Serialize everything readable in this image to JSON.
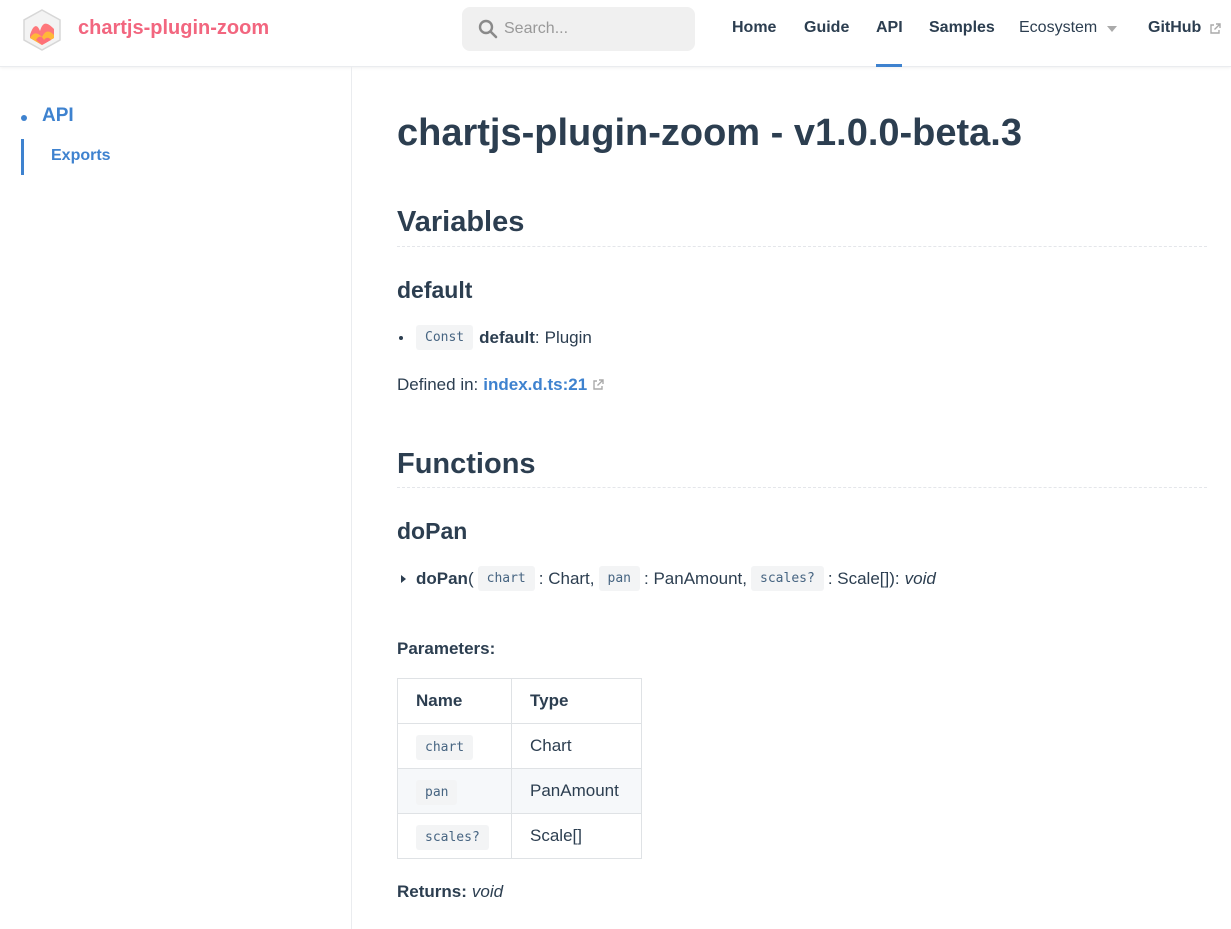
{
  "header": {
    "site_name": "chartjs-plugin-zoom",
    "search_placeholder": "Search...",
    "nav": [
      {
        "label": "Home"
      },
      {
        "label": "Guide"
      },
      {
        "label": "API"
      },
      {
        "label": "Samples"
      },
      {
        "label": "Ecosystem"
      },
      {
        "label": "GitHub"
      }
    ],
    "active_nav": "API",
    "colors": {
      "brand": "#f2667f",
      "accent": "#3e82cf"
    }
  },
  "sidebar": {
    "section": "API",
    "items": [
      {
        "label": "Exports"
      }
    ]
  },
  "main": {
    "title": "chartjs-plugin-zoom - v1.0.0-beta.3",
    "variables": {
      "heading": "Variables",
      "item_name": "default",
      "signature": {
        "badge": "Const",
        "name": "default",
        "sep": ":",
        "type": "Plugin"
      },
      "defined_in_label": "Defined in:",
      "defined_in_link": "index.d.ts:21"
    },
    "functions": {
      "heading": "Functions",
      "item_name": "doPan",
      "signature": {
        "name": "doPan",
        "open": "(",
        "params": [
          {
            "name": "chart",
            "type": ": Chart,"
          },
          {
            "name": "pan",
            "type": ": PanAmount,"
          },
          {
            "name": "scales?",
            "type": ": Scale[]):"
          }
        ],
        "return": "void"
      },
      "parameters_label": "Parameters:",
      "table": {
        "columns": [
          "Name",
          "Type"
        ],
        "rows": [
          {
            "name": "chart",
            "type": "Chart"
          },
          {
            "name": "pan",
            "type": "PanAmount"
          },
          {
            "name": "scales?",
            "type": "Scale[]"
          }
        ]
      },
      "returns_label": "Returns:",
      "returns_value": "void"
    }
  }
}
